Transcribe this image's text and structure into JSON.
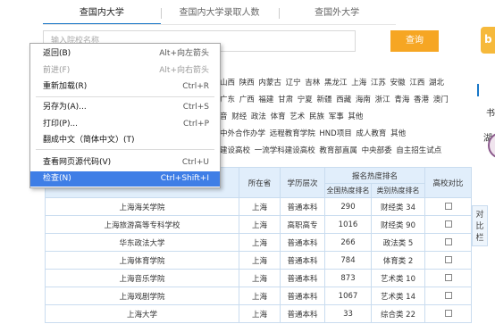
{
  "tabs": [
    "查国内大学",
    "查国内大学录取人数",
    "查国外大学"
  ],
  "search": {
    "placeholder": "输入院校名称",
    "button": "查询"
  },
  "regions": [
    "山西 陕西 内蒙古 辽宁 吉林 黑龙江 上海 江苏 安徽 江西 湖北",
    "广东 广西 福建 甘肃 宁夏 新疆 西藏 海南 浙江 青海 香港 澳门",
    "音 财经 政法 体育 艺术 民族 军事 其他",
    "中外合作办学 远程教育学院 HND项目 成人教育 其他",
    "建设高校 一流学科建设高校 教育部直属 中央部委 自主招生试点"
  ],
  "side": {
    "yellow_glyph": "b",
    "marks": [
      "书",
      "湖"
    ],
    "compare_label": [
      "对",
      "比",
      "栏"
    ]
  },
  "context_menu": {
    "items": [
      {
        "label": "返回(B)",
        "shortcut": "Alt+向左箭头",
        "disabled": false,
        "highlighted": false
      },
      {
        "label": "前进(F)",
        "shortcut": "Alt+向右箭头",
        "disabled": true,
        "highlighted": false
      },
      {
        "label": "重新加载(R)",
        "shortcut": "Ctrl+R",
        "disabled": false,
        "highlighted": false
      },
      {
        "label": "另存为(A)...",
        "shortcut": "Ctrl+S",
        "disabled": false,
        "highlighted": false
      },
      {
        "label": "打印(P)...",
        "shortcut": "Ctrl+P",
        "disabled": false,
        "highlighted": false
      },
      {
        "label": "翻成中文（简体中文）(T)",
        "shortcut": "",
        "disabled": false,
        "highlighted": false
      },
      {
        "label": "查看网页源代码(V)",
        "shortcut": "Ctrl+U",
        "disabled": false,
        "highlighted": false
      },
      {
        "label": "检查(N)",
        "shortcut": "Ctrl+Shift+I",
        "disabled": false,
        "highlighted": true
      }
    ]
  },
  "table": {
    "headers": {
      "location": "所在省",
      "level": "学历层次",
      "rank_group": "报名热度排名",
      "national": "全国热度排名",
      "category": "类别热度排名",
      "compare": "高校对比"
    },
    "rows": [
      {
        "name": "上海海关学院",
        "province": "上海",
        "level": "普通本科",
        "national": "290",
        "category": "财经类 34"
      },
      {
        "name": "上海旅游高等专科学校",
        "province": "上海",
        "level": "高职高专",
        "national": "1016",
        "category": "财经类 90"
      },
      {
        "name": "华东政法大学",
        "province": "上海",
        "level": "普通本科",
        "national": "266",
        "category": "政法类 5"
      },
      {
        "name": "上海体育学院",
        "province": "上海",
        "level": "普通本科",
        "national": "784",
        "category": "体育类 2"
      },
      {
        "name": "上海音乐学院",
        "province": "上海",
        "level": "普通本科",
        "national": "873",
        "category": "艺术类 10"
      },
      {
        "name": "上海戏剧学院",
        "province": "上海",
        "level": "普通本科",
        "national": "1067",
        "category": "艺术类 14"
      },
      {
        "name": "上海大学",
        "province": "上海",
        "level": "普通本科",
        "national": "33",
        "category": "综合类 22"
      }
    ]
  }
}
